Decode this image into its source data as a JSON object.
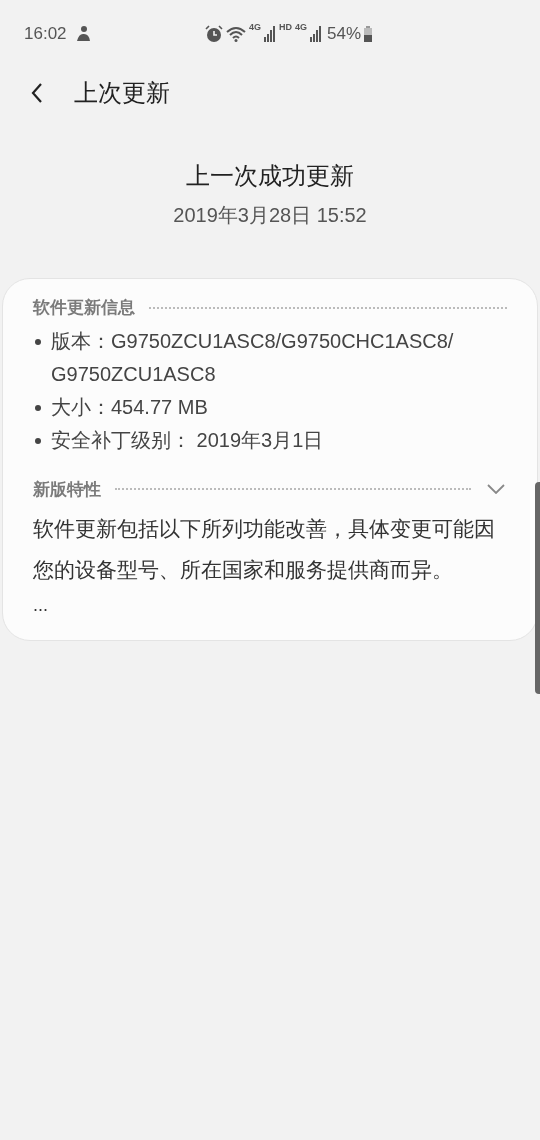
{
  "status_bar": {
    "time": "16:02",
    "network_labels": [
      "4G",
      "HD",
      "4G"
    ],
    "battery": "54%"
  },
  "header": {
    "title": "上次更新"
  },
  "summary": {
    "title": "上一次成功更新",
    "date": "2019年3月28日 15:52"
  },
  "card": {
    "sections": [
      {
        "kind": "list",
        "heading": "软件更新信息",
        "items": [
          "版本：G9750ZCU1ASC8/G9750CHC1ASC8/G9750ZCU1ASC8",
          "大小：454.77 MB",
          "安全补丁级别： 2019年3月1日"
        ]
      },
      {
        "kind": "text",
        "heading": "新版特性",
        "expanded": false,
        "text": "软件更新包括以下所列功能改善，具体变更可能因您的设备型号、所在国家和服务提供商而异。",
        "more": "..."
      }
    ]
  }
}
